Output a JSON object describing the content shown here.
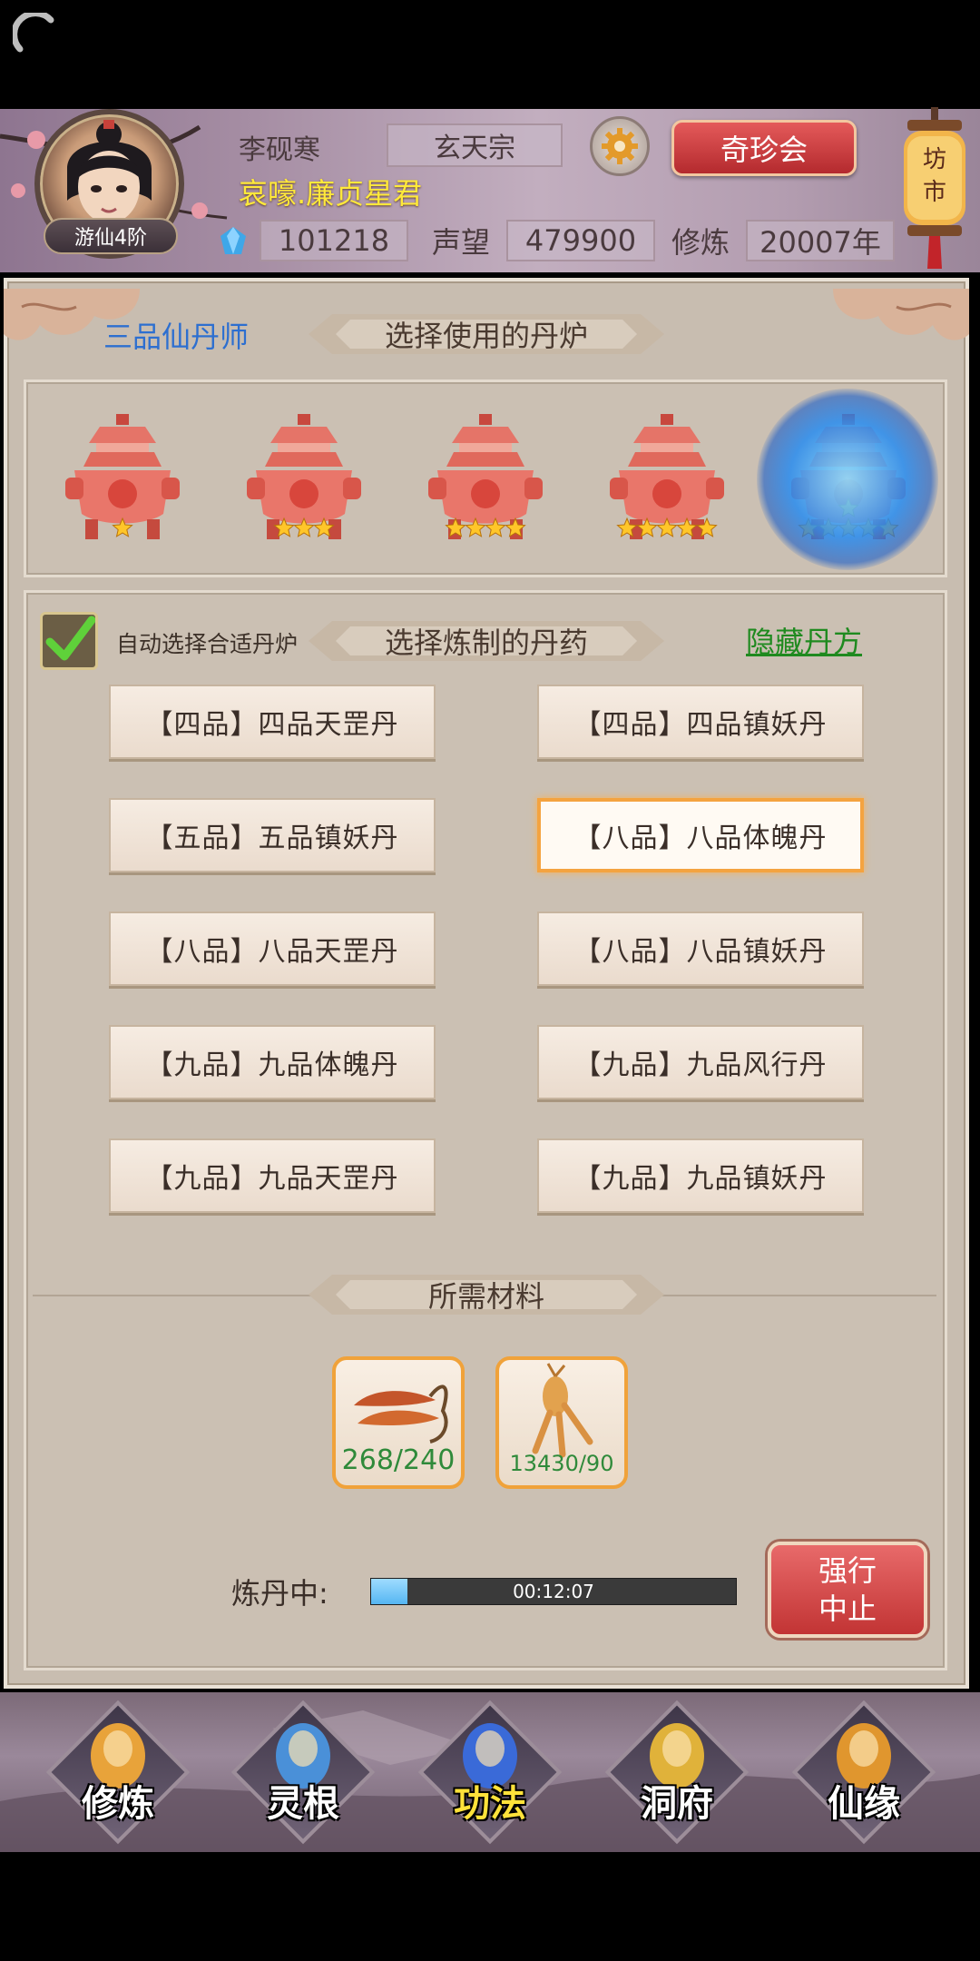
{
  "player": {
    "name": "李砚寒",
    "sect": "玄天宗",
    "title": "哀嚎.廉贞星君",
    "rank": "游仙4阶",
    "spirit_stones": "101218",
    "reputation_label": "声望",
    "reputation": "479900",
    "cultivation_label": "修炼",
    "cultivation": "20007年"
  },
  "header": {
    "treasure_button": "奇珍会",
    "market_label": "坊市"
  },
  "alchemist_grade": "三品仙丹师",
  "furnace_section": {
    "title": "选择使用的丹炉",
    "furnaces": [
      {
        "stars": 1,
        "selected": false
      },
      {
        "stars": 3,
        "selected": false
      },
      {
        "stars": 4,
        "selected": false
      },
      {
        "stars": 5,
        "selected": false
      },
      {
        "stars": 6,
        "selected": true
      }
    ]
  },
  "pill_section": {
    "auto_select_label": "自动选择合适丹炉",
    "auto_select_checked": true,
    "title": "选择炼制的丹药",
    "hide_link": "隐藏丹方",
    "pills": [
      {
        "label": "【四品】四品天罡丹",
        "selected": false
      },
      {
        "label": "【四品】四品镇妖丹",
        "selected": false
      },
      {
        "label": "【五品】五品镇妖丹",
        "selected": false
      },
      {
        "label": "【八品】八品体魄丹",
        "selected": true
      },
      {
        "label": "【八品】八品天罡丹",
        "selected": false
      },
      {
        "label": "【八品】八品镇妖丹",
        "selected": false
      },
      {
        "label": "【九品】九品体魄丹",
        "selected": false
      },
      {
        "label": "【九品】九品风行丹",
        "selected": false
      },
      {
        "label": "【九品】九品天罡丹",
        "selected": false
      },
      {
        "label": "【九品】九品镇妖丹",
        "selected": false
      }
    ]
  },
  "materials_section": {
    "title": "所需材料",
    "materials": [
      {
        "icon": "cordyceps-icon",
        "count": "268/240"
      },
      {
        "icon": "ginseng-icon",
        "count": "13430/90"
      }
    ]
  },
  "refining": {
    "label": "炼丹中:",
    "progress": 0.1,
    "time": "00:12:07",
    "stop_button_line1": "强行",
    "stop_button_line2": "中止"
  },
  "bottom_nav": [
    {
      "label": "修炼",
      "icon": "cultivate-icon",
      "active": false
    },
    {
      "label": "灵根",
      "icon": "spirit-root-icon",
      "active": false
    },
    {
      "label": "功法",
      "icon": "technique-book-icon",
      "active": true
    },
    {
      "label": "洞府",
      "icon": "cave-residence-icon",
      "active": false
    },
    {
      "label": "仙缘",
      "icon": "gourd-icon",
      "active": false
    }
  ],
  "colors": {
    "accent_red": "#c23434",
    "title_yellow": "#ffe93a",
    "link_green": "#1f8a1f",
    "grade_blue": "#2d6fd0",
    "selection_orange": "#f4a340"
  }
}
